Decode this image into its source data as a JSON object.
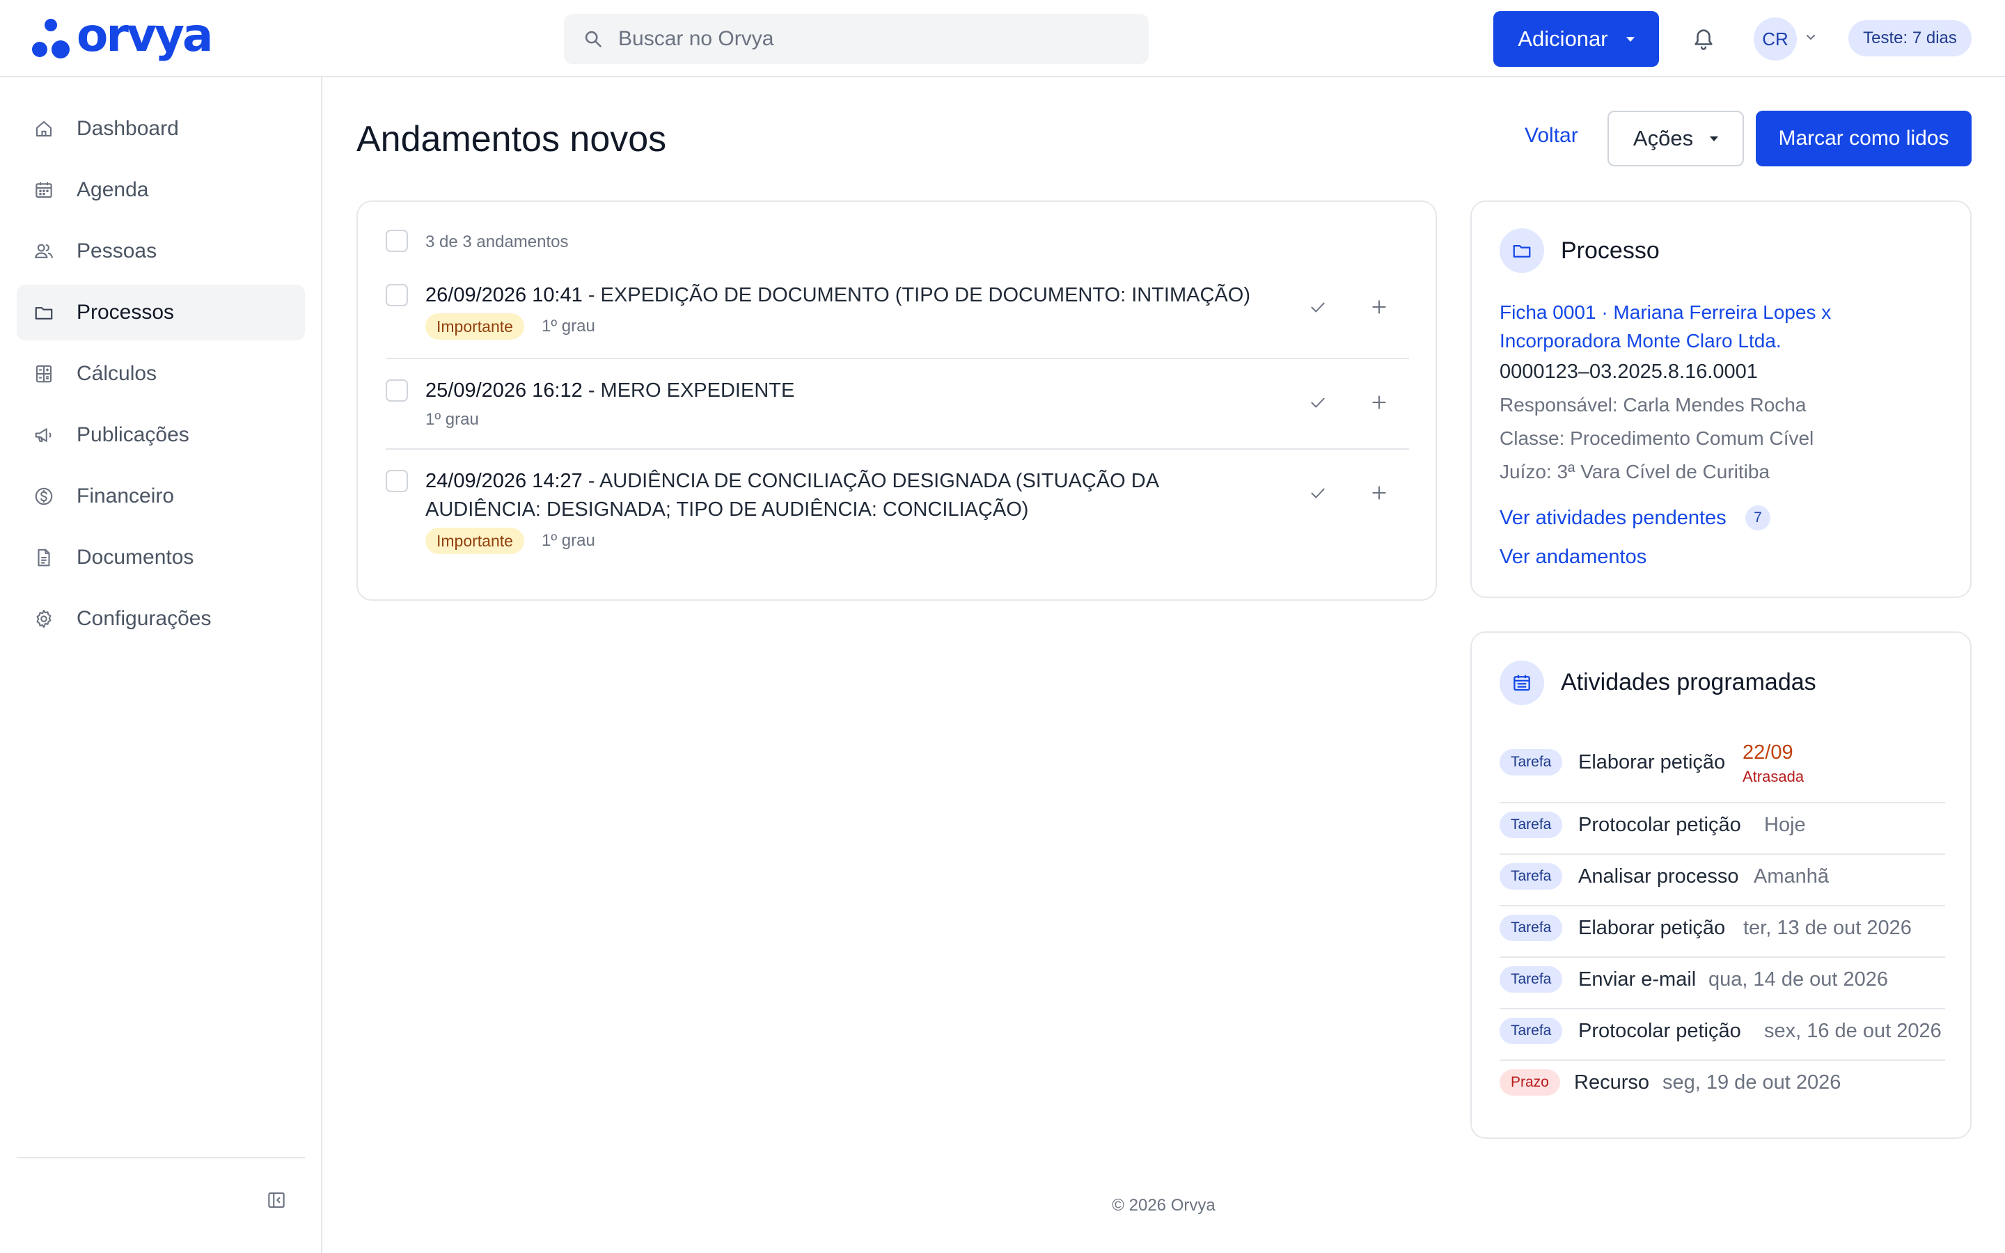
{
  "app": {
    "logo_text": "orvya",
    "brand_color": "#1447e6"
  },
  "header": {
    "search_placeholder": "Buscar no Orvya",
    "add_label": "Adicionar",
    "avatar_initials": "CR",
    "trial_label": "Teste: 7 dias"
  },
  "sidebar": {
    "items": [
      {
        "label": "Dashboard",
        "icon": "home-icon",
        "active": false
      },
      {
        "label": "Agenda",
        "icon": "calendar-icon",
        "active": false
      },
      {
        "label": "Pessoas",
        "icon": "people-icon",
        "active": false
      },
      {
        "label": "Processos",
        "icon": "folder-icon",
        "active": true
      },
      {
        "label": "Cálculos",
        "icon": "calculator-icon",
        "active": false
      },
      {
        "label": "Publicações",
        "icon": "megaphone-icon",
        "active": false
      },
      {
        "label": "Financeiro",
        "icon": "dollar-coin-icon",
        "active": false
      },
      {
        "label": "Documentos",
        "icon": "document-icon",
        "active": false
      },
      {
        "label": "Configurações",
        "icon": "gear-icon",
        "active": false
      }
    ]
  },
  "page": {
    "title": "Andamentos novos",
    "voltar_label": "Voltar",
    "acoes_label": "Ações",
    "marcar_label": "Marcar como lidos"
  },
  "andamentos": {
    "count_text": "3 de 3 andamentos",
    "rows": [
      {
        "datetime": "26/09/2026 10:41",
        "text": " - EXPEDIÇÃO DE DOCUMENTO (TIPO DE DOCUMENTO: INTIMAÇÃO)",
        "tag": "Importante",
        "grau": "1º grau"
      },
      {
        "datetime": "25/09/2026 16:12",
        "text": " - MERO EXPEDIENTE",
        "tag": "",
        "grau": "1º grau"
      },
      {
        "datetime": "24/09/2026 14:27",
        "text": " - AUDIÊNCIA DE CONCILIAÇÃO DESIGNADA (SITUAÇÃO DA AUDIÊNCIA: DESIGNADA; TIPO DE AUDIÊNCIA: CONCILIAÇÃO)",
        "tag": "Importante",
        "grau": "1º grau"
      }
    ]
  },
  "processo": {
    "heading": "Processo",
    "link_text": "Ficha 0001 · Mariana Ferreira Lopes x Incorporadora Monte Claro Ltda.",
    "number": "0000123–03.2025.8.16.0001",
    "responsavel": "Responsável: Carla Mendes Rocha",
    "classe": "Classe: Procedimento Comum Cível",
    "juizo": "Juízo: 3ª Vara Cível de Curitiba",
    "pendentes_label": "Ver atividades pendentes",
    "pendentes_count": "7",
    "andamentos_label": "Ver andamentos"
  },
  "atividades": {
    "heading": "Atividades programadas",
    "items": [
      {
        "tag": "Tarefa",
        "name": "Elaborar petição",
        "date": "22/09",
        "status": "Atrasada"
      },
      {
        "tag": "Tarefa",
        "name": "Protocolar petição",
        "date": "Hoje"
      },
      {
        "tag": "Tarefa",
        "name": "Analisar processo",
        "date": "Amanhã"
      },
      {
        "tag": "Tarefa",
        "name": "Elaborar petição",
        "date": "ter, 13 de out 2026"
      },
      {
        "tag": "Tarefa",
        "name": "Enviar e-mail",
        "date": "qua, 14 de out 2026"
      },
      {
        "tag": "Tarefa",
        "name": "Protocolar petição",
        "date": "sex, 16 de out 2026"
      },
      {
        "tag": "Prazo",
        "name": "Recurso",
        "date": "seg, 19 de out 2026"
      }
    ]
  },
  "footer": {
    "text": "© 2026 Orvya"
  }
}
